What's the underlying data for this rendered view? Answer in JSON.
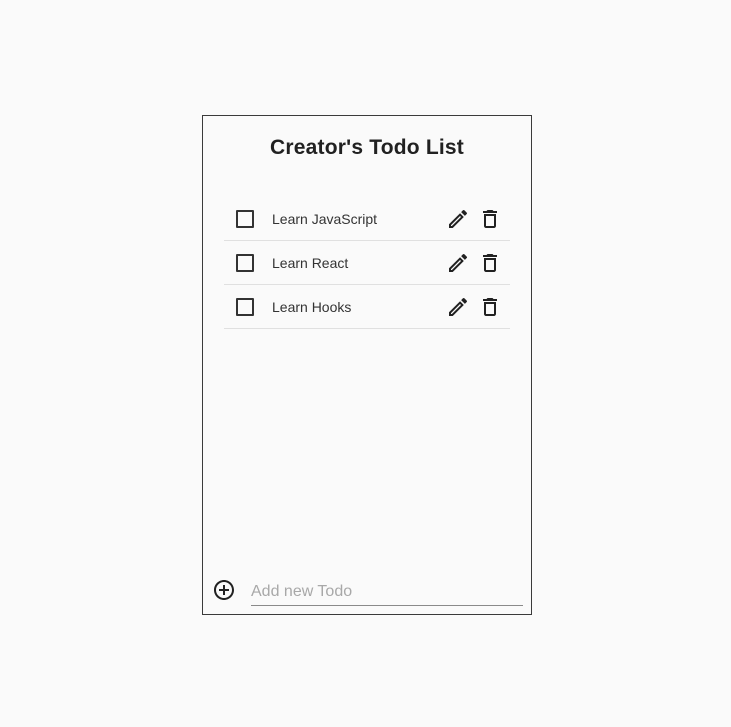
{
  "title": "Creator's Todo List",
  "todos": [
    {
      "label": "Learn JavaScript",
      "checked": false
    },
    {
      "label": "Learn React",
      "checked": false
    },
    {
      "label": "Learn Hooks",
      "checked": false
    }
  ],
  "new_todo": {
    "placeholder": "Add new Todo",
    "value": ""
  },
  "icons": {
    "add": "add-circle-icon",
    "edit": "pencil-icon",
    "delete": "trash-icon",
    "checkbox": "checkbox-unchecked"
  }
}
